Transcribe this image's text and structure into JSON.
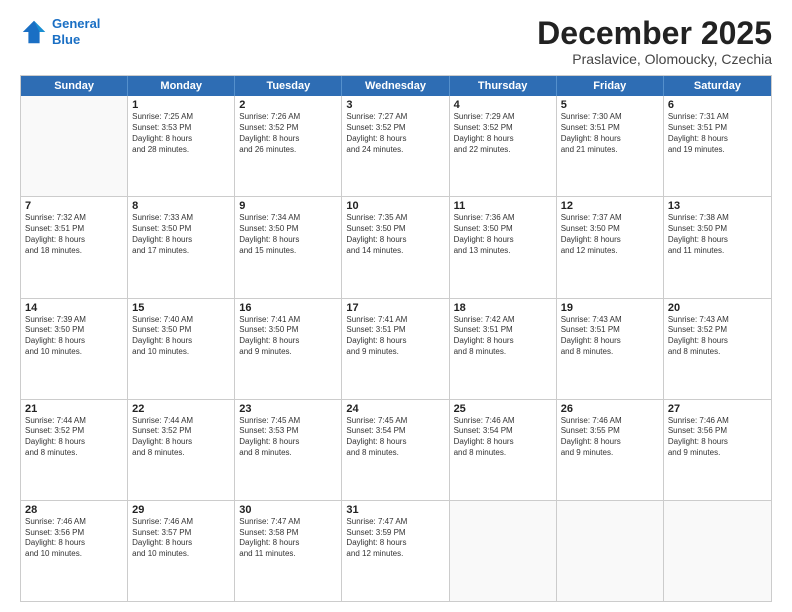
{
  "logo": {
    "line1": "General",
    "line2": "Blue"
  },
  "title": "December 2025",
  "subtitle": "Praslavice, Olomoucky, Czechia",
  "header_days": [
    "Sunday",
    "Monday",
    "Tuesday",
    "Wednesday",
    "Thursday",
    "Friday",
    "Saturday"
  ],
  "weeks": [
    [
      {
        "day": "",
        "info": ""
      },
      {
        "day": "1",
        "info": "Sunrise: 7:25 AM\nSunset: 3:53 PM\nDaylight: 8 hours\nand 28 minutes."
      },
      {
        "day": "2",
        "info": "Sunrise: 7:26 AM\nSunset: 3:52 PM\nDaylight: 8 hours\nand 26 minutes."
      },
      {
        "day": "3",
        "info": "Sunrise: 7:27 AM\nSunset: 3:52 PM\nDaylight: 8 hours\nand 24 minutes."
      },
      {
        "day": "4",
        "info": "Sunrise: 7:29 AM\nSunset: 3:52 PM\nDaylight: 8 hours\nand 22 minutes."
      },
      {
        "day": "5",
        "info": "Sunrise: 7:30 AM\nSunset: 3:51 PM\nDaylight: 8 hours\nand 21 minutes."
      },
      {
        "day": "6",
        "info": "Sunrise: 7:31 AM\nSunset: 3:51 PM\nDaylight: 8 hours\nand 19 minutes."
      }
    ],
    [
      {
        "day": "7",
        "info": "Sunrise: 7:32 AM\nSunset: 3:51 PM\nDaylight: 8 hours\nand 18 minutes."
      },
      {
        "day": "8",
        "info": "Sunrise: 7:33 AM\nSunset: 3:50 PM\nDaylight: 8 hours\nand 17 minutes."
      },
      {
        "day": "9",
        "info": "Sunrise: 7:34 AM\nSunset: 3:50 PM\nDaylight: 8 hours\nand 15 minutes."
      },
      {
        "day": "10",
        "info": "Sunrise: 7:35 AM\nSunset: 3:50 PM\nDaylight: 8 hours\nand 14 minutes."
      },
      {
        "day": "11",
        "info": "Sunrise: 7:36 AM\nSunset: 3:50 PM\nDaylight: 8 hours\nand 13 minutes."
      },
      {
        "day": "12",
        "info": "Sunrise: 7:37 AM\nSunset: 3:50 PM\nDaylight: 8 hours\nand 12 minutes."
      },
      {
        "day": "13",
        "info": "Sunrise: 7:38 AM\nSunset: 3:50 PM\nDaylight: 8 hours\nand 11 minutes."
      }
    ],
    [
      {
        "day": "14",
        "info": "Sunrise: 7:39 AM\nSunset: 3:50 PM\nDaylight: 8 hours\nand 10 minutes."
      },
      {
        "day": "15",
        "info": "Sunrise: 7:40 AM\nSunset: 3:50 PM\nDaylight: 8 hours\nand 10 minutes."
      },
      {
        "day": "16",
        "info": "Sunrise: 7:41 AM\nSunset: 3:50 PM\nDaylight: 8 hours\nand 9 minutes."
      },
      {
        "day": "17",
        "info": "Sunrise: 7:41 AM\nSunset: 3:51 PM\nDaylight: 8 hours\nand 9 minutes."
      },
      {
        "day": "18",
        "info": "Sunrise: 7:42 AM\nSunset: 3:51 PM\nDaylight: 8 hours\nand 8 minutes."
      },
      {
        "day": "19",
        "info": "Sunrise: 7:43 AM\nSunset: 3:51 PM\nDaylight: 8 hours\nand 8 minutes."
      },
      {
        "day": "20",
        "info": "Sunrise: 7:43 AM\nSunset: 3:52 PM\nDaylight: 8 hours\nand 8 minutes."
      }
    ],
    [
      {
        "day": "21",
        "info": "Sunrise: 7:44 AM\nSunset: 3:52 PM\nDaylight: 8 hours\nand 8 minutes."
      },
      {
        "day": "22",
        "info": "Sunrise: 7:44 AM\nSunset: 3:52 PM\nDaylight: 8 hours\nand 8 minutes."
      },
      {
        "day": "23",
        "info": "Sunrise: 7:45 AM\nSunset: 3:53 PM\nDaylight: 8 hours\nand 8 minutes."
      },
      {
        "day": "24",
        "info": "Sunrise: 7:45 AM\nSunset: 3:54 PM\nDaylight: 8 hours\nand 8 minutes."
      },
      {
        "day": "25",
        "info": "Sunrise: 7:46 AM\nSunset: 3:54 PM\nDaylight: 8 hours\nand 8 minutes."
      },
      {
        "day": "26",
        "info": "Sunrise: 7:46 AM\nSunset: 3:55 PM\nDaylight: 8 hours\nand 9 minutes."
      },
      {
        "day": "27",
        "info": "Sunrise: 7:46 AM\nSunset: 3:56 PM\nDaylight: 8 hours\nand 9 minutes."
      }
    ],
    [
      {
        "day": "28",
        "info": "Sunrise: 7:46 AM\nSunset: 3:56 PM\nDaylight: 8 hours\nand 10 minutes."
      },
      {
        "day": "29",
        "info": "Sunrise: 7:46 AM\nSunset: 3:57 PM\nDaylight: 8 hours\nand 10 minutes."
      },
      {
        "day": "30",
        "info": "Sunrise: 7:47 AM\nSunset: 3:58 PM\nDaylight: 8 hours\nand 11 minutes."
      },
      {
        "day": "31",
        "info": "Sunrise: 7:47 AM\nSunset: 3:59 PM\nDaylight: 8 hours\nand 12 minutes."
      },
      {
        "day": "",
        "info": ""
      },
      {
        "day": "",
        "info": ""
      },
      {
        "day": "",
        "info": ""
      }
    ]
  ]
}
